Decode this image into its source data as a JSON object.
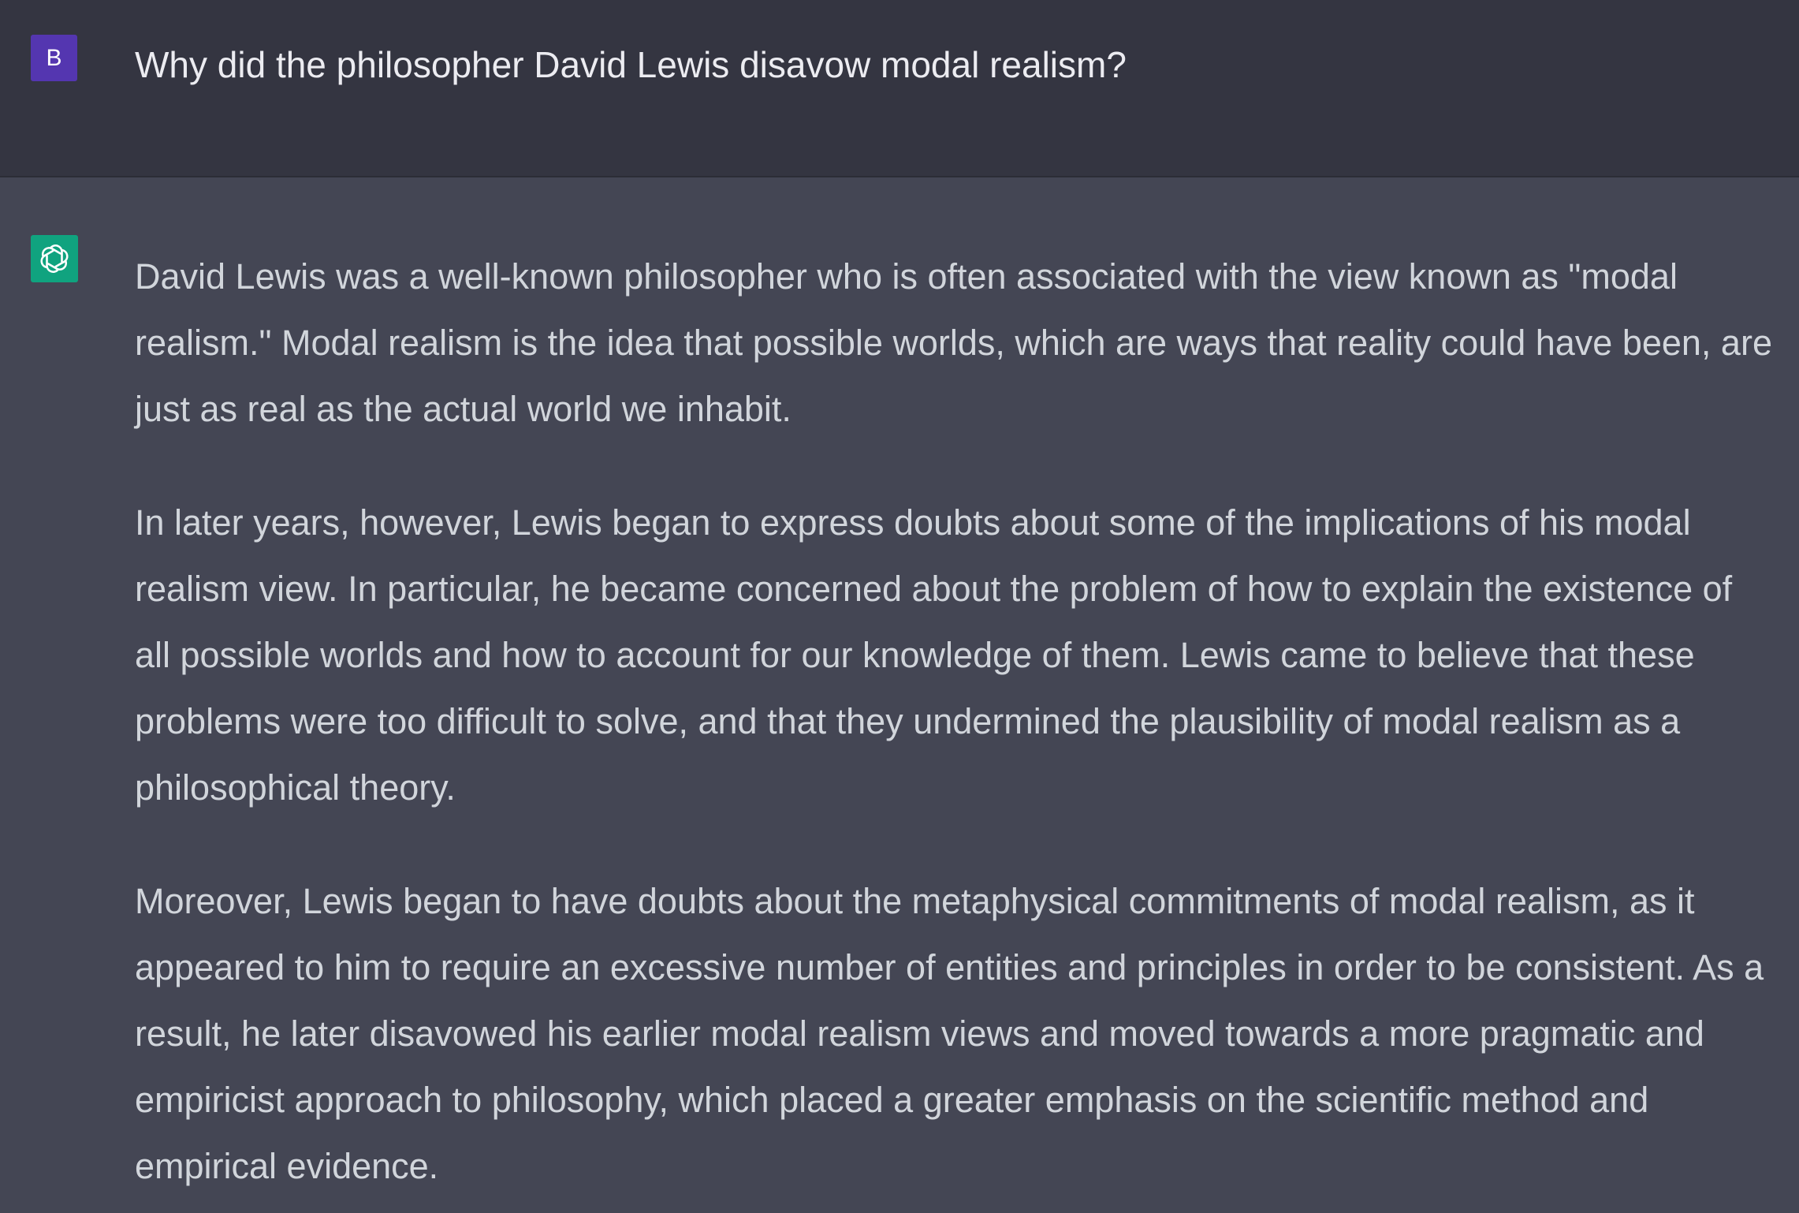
{
  "user": {
    "avatar_letter": "B",
    "avatar_color": "#5436b0",
    "message": "Why did the philosopher David Lewis disavow modal realism?"
  },
  "assistant": {
    "avatar_icon": "openai-logo-icon",
    "avatar_color": "#10a37f",
    "paragraphs": [
      "David Lewis was a well-known philosopher who is often associated with the view known as \"modal realism.\" Modal realism is the idea that possible worlds, which are ways that reality could have been, are just as real as the actual world we inhabit.",
      "In later years, however, Lewis began to express doubts about some of the implications of his modal realism view. In particular, he became concerned about the problem of how to explain the existence of all possible worlds and how to account for our knowledge of them. Lewis came to believe that these problems were too difficult to solve, and that they undermined the plausibility of modal realism as a philosophical theory.",
      "Moreover, Lewis began to have doubts about the metaphysical commitments of modal realism, as it appeared to him to require an excessive number of entities and principles in order to be consistent. As a result, he later disavowed his earlier modal realism views and moved towards a more pragmatic and empiricist approach to philosophy, which placed a greater emphasis on the scientific method and empirical evidence."
    ]
  }
}
